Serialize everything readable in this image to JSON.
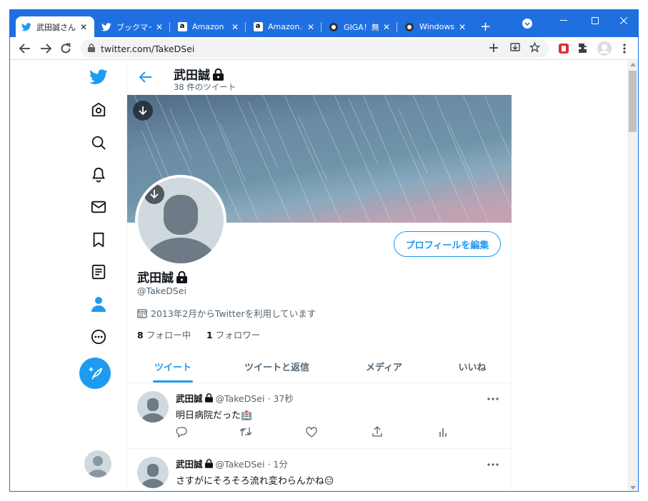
{
  "browser": {
    "tabs": [
      {
        "title": "武田誠さん",
        "icon": "twitter-icon",
        "active": true
      },
      {
        "title": "ブックマーク",
        "icon": "twitter-icon",
        "active": false
      },
      {
        "title": "Amazon | ",
        "icon": "amazon-icon",
        "active": false
      },
      {
        "title": "Amazon.co",
        "icon": "amazon-icon",
        "active": false
      },
      {
        "title": "GIGA！無",
        "icon": "giga-icon",
        "active": false
      },
      {
        "title": "Windows",
        "icon": "giga-icon",
        "active": false
      }
    ],
    "new_tab": "+",
    "url": "twitter.com/TakeDSei",
    "accent": "#1f6fe0"
  },
  "profile": {
    "header_name": "武田誠",
    "tweet_count": "38 件のツイート",
    "name": "武田誠",
    "handle": "@TakeDSei",
    "joined": "2013年2月からTwitterを利用しています",
    "following_count": "8",
    "following_label": "フォロー中",
    "followers_count": "1",
    "followers_label": "フォロワー",
    "edit_button": "プロフィールを編集"
  },
  "profile_tabs": [
    "ツイート",
    "ツイートと返信",
    "メディア",
    "いいね"
  ],
  "tweets": [
    {
      "name": "武田誠",
      "handle": "@TakeDSei",
      "time": "· 37秒",
      "text": "明日病院だった🏥"
    },
    {
      "name": "武田誠",
      "handle": "@TakeDSei",
      "time": "· 1分",
      "text": "さすがにそろそろ流れ変わらんかね😑"
    }
  ],
  "colors": {
    "twitter_blue": "#1d9bf0",
    "text": "#0f1419",
    "secondary": "#536471"
  }
}
